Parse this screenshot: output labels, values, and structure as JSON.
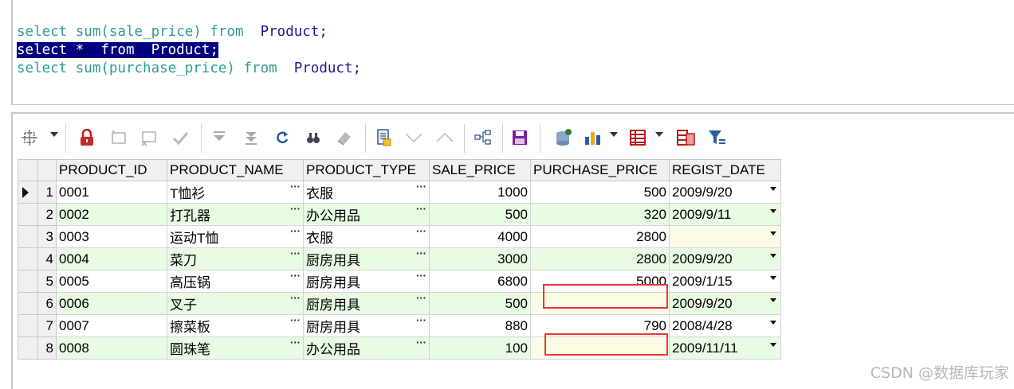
{
  "editor": {
    "line1": {
      "kw1": "select",
      "fn": "sum(sale_price)",
      "kw2": "from",
      "table": "Product;"
    },
    "line2": {
      "text": "select *  from  Product;"
    },
    "line3": {
      "kw1": "select",
      "fn": "sum(purchase_price)",
      "kw2": "from",
      "table": "Product;"
    }
  },
  "toolbar": {
    "icons": [
      "move-icon",
      "lock-icon",
      "new-record-icon",
      "cancel-record-icon",
      "post-check-icon",
      "first-record-icon",
      "last-record-icon",
      "refresh-icon",
      "find-icon",
      "clear-icon",
      "export-icon",
      "move-down-icon",
      "move-up-icon",
      "tree-icon",
      "save-icon",
      "db-upload-icon",
      "chart-icon",
      "grid-layout-icon",
      "columns-icon",
      "filter-icon"
    ]
  },
  "grid": {
    "columns": [
      "PRODUCT_ID",
      "PRODUCT_NAME",
      "PRODUCT_TYPE",
      "SALE_PRICE",
      "PURCHASE_PRICE",
      "REGIST_DATE"
    ],
    "rows": [
      {
        "n": "1",
        "id": "0001",
        "name": "T恤衫",
        "type": "衣服",
        "sale": "1000",
        "purchase": "500",
        "date": "2009/9/20"
      },
      {
        "n": "2",
        "id": "0002",
        "name": "打孔器",
        "type": "办公用品",
        "sale": "500",
        "purchase": "320",
        "date": "2009/9/11"
      },
      {
        "n": "3",
        "id": "0003",
        "name": "运动T恤",
        "type": "衣服",
        "sale": "4000",
        "purchase": "2800",
        "date": ""
      },
      {
        "n": "4",
        "id": "0004",
        "name": "菜刀",
        "type": "厨房用具",
        "sale": "3000",
        "purchase": "2800",
        "date": "2009/9/20"
      },
      {
        "n": "5",
        "id": "0005",
        "name": "高压锅",
        "type": "厨房用具",
        "sale": "6800",
        "purchase": "5000",
        "date": "2009/1/15"
      },
      {
        "n": "6",
        "id": "0006",
        "name": "叉子",
        "type": "厨房用具",
        "sale": "500",
        "purchase": "",
        "date": "2009/9/20"
      },
      {
        "n": "7",
        "id": "0007",
        "name": "擦菜板",
        "type": "厨房用具",
        "sale": "880",
        "purchase": "790",
        "date": "2008/4/28"
      },
      {
        "n": "8",
        "id": "0008",
        "name": "圆珠笔",
        "type": "办公用品",
        "sale": "100",
        "purchase": "",
        "date": "2009/11/11"
      }
    ],
    "ellipsis": "···"
  },
  "watermark": "CSDN @数据库玩家",
  "colors": {
    "keyword": "#2d9a98",
    "identifier": "#1a1a8a",
    "selection": "#00007f",
    "even_row": "#e8fbe3",
    "highlight_box": "#e53935"
  }
}
